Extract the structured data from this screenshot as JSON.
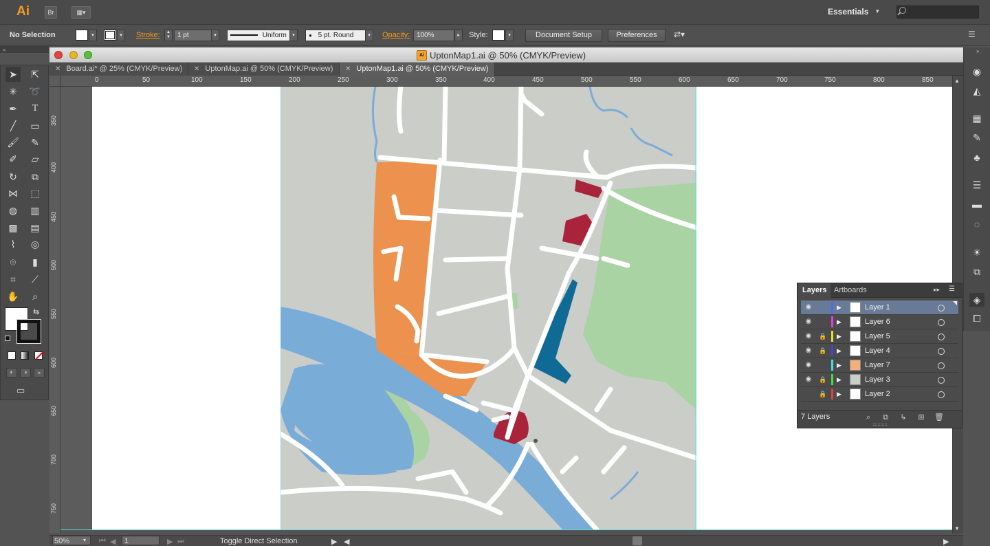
{
  "app": {
    "logo": "Ai",
    "bridge_button": "Br",
    "workspace": "Essentials",
    "search_placeholder": ""
  },
  "control_bar": {
    "selection_status": "No Selection",
    "stroke_label": "Stroke:",
    "stroke_weight": "1 pt",
    "profile_value": "Uniform",
    "brush_value": "5 pt. Round",
    "opacity_label": "Opacity:",
    "opacity_value": "100%",
    "style_label": "Style:",
    "document_setup_button": "Document Setup",
    "preferences_button": "Preferences"
  },
  "document": {
    "window_title": "UptonMap1.ai @ 50% (CMYK/Preview)",
    "tabs": [
      {
        "label": "Board.ai* @ 25% (CMYK/Preview)",
        "active": false
      },
      {
        "label": "UptonMap.ai @ 50% (CMYK/Preview)",
        "active": false
      },
      {
        "label": "UptonMap1.ai @ 50% (CMYK/Preview)",
        "active": true
      }
    ],
    "ruler_h": [
      "0",
      "50",
      "100",
      "150",
      "200",
      "250",
      "300",
      "350",
      "400",
      "450",
      "500",
      "550",
      "600",
      "650",
      "700",
      "750",
      "800",
      "850"
    ],
    "ruler_v": [
      "350",
      "400",
      "450",
      "500",
      "550",
      "600",
      "650",
      "700",
      "750"
    ]
  },
  "status_bar": {
    "zoom": "50%",
    "artboard_number": "1",
    "status_text": "Toggle Direct Selection"
  },
  "layers_panel": {
    "tab_layers": "Layers",
    "tab_artboards": "Artboards",
    "count_label": "7 Layers",
    "layers": [
      {
        "name": "Layer 1",
        "color": "#4a6cf0",
        "visible": true,
        "locked": false,
        "selected": true
      },
      {
        "name": "Layer 6",
        "color": "#e040e0",
        "visible": true,
        "locked": false,
        "selected": false
      },
      {
        "name": "Layer 5",
        "color": "#e8e020",
        "visible": true,
        "locked": true,
        "selected": false
      },
      {
        "name": "Layer 4",
        "color": "#4a40e0",
        "visible": true,
        "locked": true,
        "selected": false
      },
      {
        "name": "Layer 7",
        "color": "#40e0e8",
        "visible": true,
        "locked": false,
        "selected": false
      },
      {
        "name": "Layer 3",
        "color": "#40e040",
        "visible": true,
        "locked": true,
        "selected": false
      },
      {
        "name": "Layer 2",
        "color": "#e04040",
        "visible": false,
        "locked": true,
        "selected": false
      }
    ]
  },
  "map_colors": {
    "land": "#cbcdc9",
    "water": "#7aacd8",
    "park": "#a9d3a3",
    "residential": "#ec924e",
    "landmark_red": "#a9243a",
    "landmark_blue": "#0f6b96",
    "road": "#ffffff"
  }
}
